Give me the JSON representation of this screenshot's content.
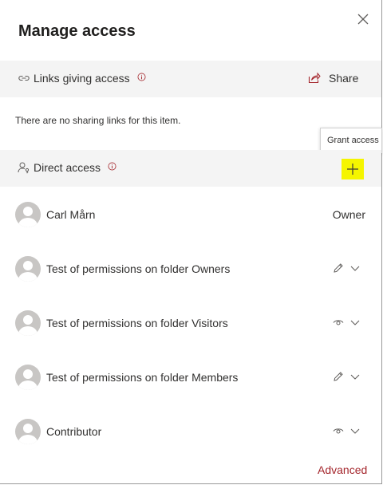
{
  "panel": {
    "title": "Manage access",
    "close_icon": "close-icon"
  },
  "links_section": {
    "label": "Links giving access",
    "share_label": "Share",
    "empty_text": "There are no sharing links for this item."
  },
  "direct_section": {
    "label": "Direct access",
    "grant_tooltip": "Grant access",
    "grant_icon": "plus-icon",
    "highlight_color": "#f5f500"
  },
  "people": [
    {
      "name": "Carl Mårn",
      "role": "Owner",
      "permission_icon": ""
    },
    {
      "name": "Test of permissions on folder Owners",
      "role": "",
      "permission_icon": "edit-icon"
    },
    {
      "name": "Test of permissions on folder Visitors",
      "role": "",
      "permission_icon": "view-icon"
    },
    {
      "name": "Test of permissions on folder Members",
      "role": "",
      "permission_icon": "edit-icon"
    },
    {
      "name": "Contributor",
      "role": "",
      "permission_icon": "view-icon"
    }
  ],
  "advanced_label": "Advanced",
  "colors": {
    "accent_red": "#a4262c",
    "section_bg": "#f4f4f4",
    "avatar_gray": "#c8c6c4"
  }
}
